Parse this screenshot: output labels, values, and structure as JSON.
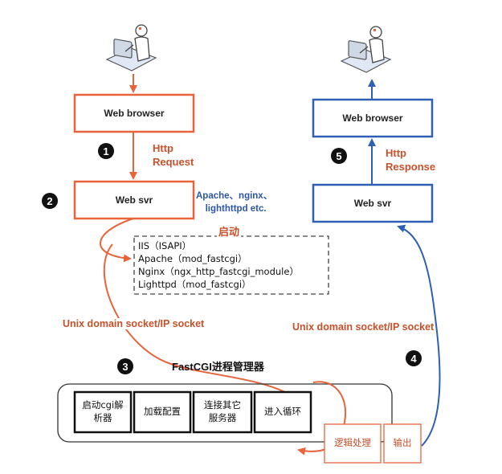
{
  "left_browser": "Web browser",
  "left_server": "Web svr",
  "right_browser": "Web browser",
  "right_server": "Web svr",
  "http_request": [
    "Http",
    "Request"
  ],
  "http_response": [
    "Http",
    "Response"
  ],
  "server_examples": [
    "Apache、nginx、",
    "lighthttpd etc."
  ],
  "startup_label": "启动",
  "modules": [
    "IIS（ISAPI）",
    "Apache（mod_fastcgi）",
    "Nginx（ngx_http_fastcgi_module）",
    "Lighttpd（mod_fastcgi）"
  ],
  "socket_left": "Unix domain socket/IP socket",
  "socket_right": "Unix domain socket/IP socket",
  "manager_title": "FastCGI进程管理器",
  "process_steps": [
    [
      "启动cgi解",
      "析器"
    ],
    [
      "加载配置"
    ],
    [
      "连接其它",
      "服务器"
    ],
    [
      "进入循环"
    ]
  ],
  "logic_label": "逻辑处理",
  "output_label": "输出",
  "step_numbers": [
    "1",
    "2",
    "3",
    "4",
    "5"
  ],
  "colors": {
    "orange": "#e8633a",
    "blue": "#2f5fb3",
    "dark": "#111111"
  },
  "icons": [
    "user-at-computer-icon",
    "user-at-computer-icon"
  ]
}
